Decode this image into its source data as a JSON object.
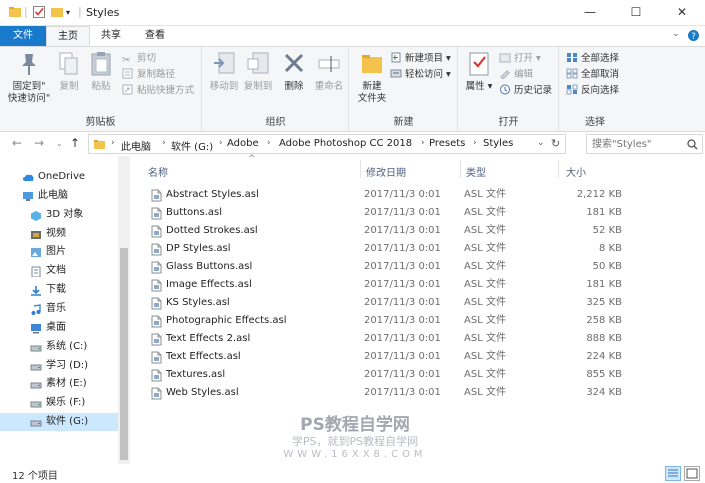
{
  "window": {
    "title": "Styles",
    "minimize": "—",
    "maximize": "☐",
    "close": "✕"
  },
  "tabs": {
    "file": "文件",
    "home": "主页",
    "share": "共享",
    "view": "查看"
  },
  "ribbon": {
    "clipboard": {
      "label": "剪贴板",
      "pin": [
        "固定到\"",
        "快速访问\""
      ],
      "copy": "复制",
      "paste": "粘贴",
      "cut": "剪切",
      "copy_path": "复制路径",
      "paste_shortcut": "粘贴快捷方式"
    },
    "organize": {
      "label": "组织",
      "move_to": "移动到",
      "copy_to": "复制到",
      "delete": "删除",
      "rename": "重命名"
    },
    "new": {
      "label": "新建",
      "new_folder": [
        "新建",
        "文件夹"
      ],
      "new_item": "新建项目",
      "easy_access": "轻松访问"
    },
    "open": {
      "label": "打开",
      "properties": "属性",
      "open": "打开",
      "edit": "编辑",
      "history": "历史记录"
    },
    "select": {
      "label": "选择",
      "select_all": "全部选择",
      "select_none": "全部取消",
      "invert": "反向选择"
    }
  },
  "address": {
    "breadcrumb": [
      "此电脑",
      "软件 (G:)",
      "Adobe",
      "Adobe Photoshop CC 2018",
      "Presets",
      "Styles"
    ],
    "search_placeholder": "搜索\"Styles\""
  },
  "nav": [
    {
      "label": "OneDrive",
      "icon": "cloud-icon",
      "indent": 1
    },
    {
      "label": "此电脑",
      "icon": "computer-icon",
      "indent": 1
    },
    {
      "label": "3D 对象",
      "icon": "cube-icon",
      "indent": 2
    },
    {
      "label": "视频",
      "icon": "video-icon",
      "indent": 2
    },
    {
      "label": "图片",
      "icon": "picture-icon",
      "indent": 2
    },
    {
      "label": "文档",
      "icon": "document-icon",
      "indent": 2
    },
    {
      "label": "下载",
      "icon": "download-icon",
      "indent": 2
    },
    {
      "label": "音乐",
      "icon": "music-icon",
      "indent": 2
    },
    {
      "label": "桌面",
      "icon": "desktop-icon",
      "indent": 2
    },
    {
      "label": "系统 (C:)",
      "icon": "drive-icon",
      "indent": 2
    },
    {
      "label": "学习 (D:)",
      "icon": "drive-icon",
      "indent": 2
    },
    {
      "label": "素材 (E:)",
      "icon": "drive-icon",
      "indent": 2
    },
    {
      "label": "娱乐 (F:)",
      "icon": "drive-icon",
      "indent": 2
    },
    {
      "label": "软件 (G:)",
      "icon": "drive-icon",
      "indent": 2,
      "selected": true
    }
  ],
  "columns": {
    "name": "名称",
    "date": "修改日期",
    "type": "类型",
    "size": "大小"
  },
  "files": [
    {
      "name": "Abstract Styles.asl",
      "date": "2017/11/3 0:01",
      "type": "ASL 文件",
      "size": "2,212 KB"
    },
    {
      "name": "Buttons.asl",
      "date": "2017/11/3 0:01",
      "type": "ASL 文件",
      "size": "181 KB"
    },
    {
      "name": "Dotted Strokes.asl",
      "date": "2017/11/3 0:01",
      "type": "ASL 文件",
      "size": "52 KB"
    },
    {
      "name": "DP Styles.asl",
      "date": "2017/11/3 0:01",
      "type": "ASL 文件",
      "size": "8 KB"
    },
    {
      "name": "Glass Buttons.asl",
      "date": "2017/11/3 0:01",
      "type": "ASL 文件",
      "size": "50 KB"
    },
    {
      "name": "Image Effects.asl",
      "date": "2017/11/3 0:01",
      "type": "ASL 文件",
      "size": "181 KB"
    },
    {
      "name": "KS Styles.asl",
      "date": "2017/11/3 0:01",
      "type": "ASL 文件",
      "size": "325 KB"
    },
    {
      "name": "Photographic Effects.asl",
      "date": "2017/11/3 0:01",
      "type": "ASL 文件",
      "size": "258 KB"
    },
    {
      "name": "Text Effects 2.asl",
      "date": "2017/11/3 0:01",
      "type": "ASL 文件",
      "size": "888 KB"
    },
    {
      "name": "Text Effects.asl",
      "date": "2017/11/3 0:01",
      "type": "ASL 文件",
      "size": "224 KB"
    },
    {
      "name": "Textures.asl",
      "date": "2017/11/3 0:01",
      "type": "ASL 文件",
      "size": "855 KB"
    },
    {
      "name": "Web Styles.asl",
      "date": "2017/11/3 0:01",
      "type": "ASL 文件",
      "size": "324 KB"
    }
  ],
  "status": {
    "count": "12 个项目"
  },
  "watermark": {
    "line1": "PS教程自学网",
    "line2": "学PS，就到PS教程自学网",
    "line3": "WWW.16XX8.COM"
  },
  "colors": {
    "accent": "#1979ca",
    "folder": "#f3c34b",
    "selected": "#cce8ff"
  }
}
